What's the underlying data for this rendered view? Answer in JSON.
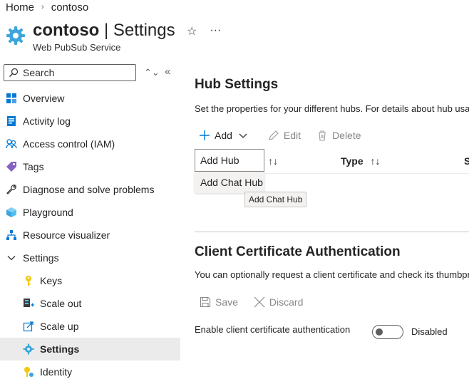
{
  "breadcrumb": {
    "home": "Home",
    "resource": "contoso"
  },
  "header": {
    "resource_name": "contoso",
    "separator": " | ",
    "page_name": "Settings",
    "subtitle": "Web PubSub Service"
  },
  "search": {
    "placeholder": "Search"
  },
  "sidebar": {
    "items": [
      {
        "label": "Overview",
        "icon": "overview-icon"
      },
      {
        "label": "Activity log",
        "icon": "activity-log-icon"
      },
      {
        "label": "Access control (IAM)",
        "icon": "people-icon"
      },
      {
        "label": "Tags",
        "icon": "tag-icon"
      },
      {
        "label": "Diagnose and solve problems",
        "icon": "wrench-icon"
      },
      {
        "label": "Playground",
        "icon": "cube-icon"
      },
      {
        "label": "Resource visualizer",
        "icon": "hierarchy-icon"
      },
      {
        "label": "Settings",
        "icon": "chevron-down-icon"
      },
      {
        "label": "Keys",
        "icon": "key-icon"
      },
      {
        "label": "Scale out",
        "icon": "scale-out-icon"
      },
      {
        "label": "Scale up",
        "icon": "scale-up-icon"
      },
      {
        "label": "Settings",
        "icon": "gear-icon"
      },
      {
        "label": "Identity",
        "icon": "identity-icon"
      }
    ]
  },
  "hub_settings": {
    "title": "Hub Settings",
    "description": "Set the properties for your different hubs. For details about hub usage",
    "add_label": "Add",
    "edit_label": "Edit",
    "delete_label": "Delete",
    "menu_add_hub": "Add Hub",
    "menu_add_chat_hub": "Add Chat Hub",
    "tooltip": "Add Chat Hub",
    "col_type": "Type",
    "col_next": "S"
  },
  "client_cert": {
    "title": "Client Certificate Authentication",
    "description": "You can optionally request a client certificate and check its thumbprint",
    "save_label": "Save",
    "discard_label": "Discard",
    "toggle_label": "Enable client certificate authentication",
    "toggle_state": "Disabled"
  },
  "colors": {
    "accent": "#0078d4",
    "selected_bg": "#ebebeb"
  }
}
